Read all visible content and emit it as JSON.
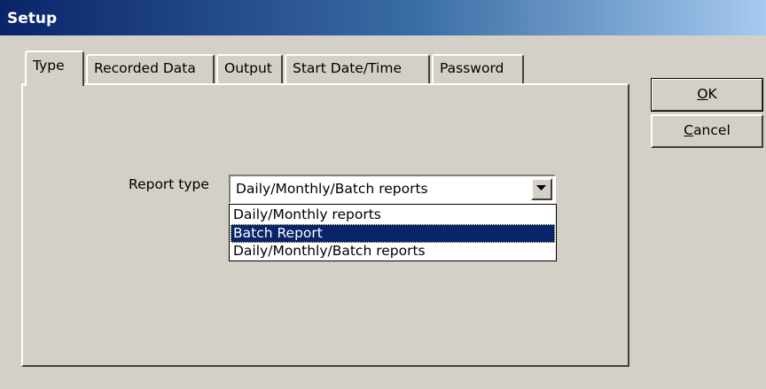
{
  "window": {
    "title": "Setup"
  },
  "tabs": [
    {
      "label": "Type",
      "selected": true
    },
    {
      "label": "Recorded Data",
      "selected": false
    },
    {
      "label": "Output",
      "selected": false
    },
    {
      "label": "Start Date/Time",
      "selected": false
    },
    {
      "label": "Password",
      "selected": false
    }
  ],
  "buttons": {
    "ok": {
      "mnemonic": "O",
      "rest": "K"
    },
    "cancel": {
      "mnemonic": "C",
      "rest": "ancel"
    }
  },
  "report_type": {
    "label": "Report type",
    "selected_value": "Daily/Monthly/Batch reports",
    "options": [
      {
        "label": "Daily/Monthly reports",
        "highlighted": false
      },
      {
        "label": "Batch Report",
        "highlighted": true
      },
      {
        "label": "Daily/Monthly/Batch reports",
        "highlighted": false
      }
    ]
  },
  "colors": {
    "title_gradient_start": "#0a246a",
    "title_gradient_end": "#a6caf0",
    "selection": "#0a246a",
    "face": "#d4d0c8"
  }
}
